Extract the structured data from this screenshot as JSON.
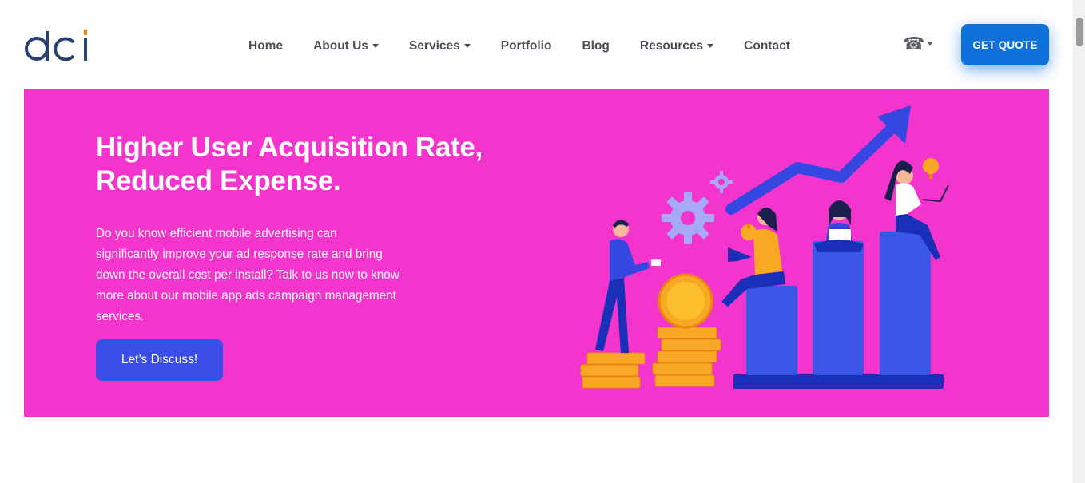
{
  "header": {
    "logo_text": "dci",
    "nav": [
      {
        "label": "Home",
        "dropdown": false
      },
      {
        "label": "About Us",
        "dropdown": true
      },
      {
        "label": "Services",
        "dropdown": true
      },
      {
        "label": "Portfolio",
        "dropdown": false
      },
      {
        "label": "Blog",
        "dropdown": false
      },
      {
        "label": "Resources",
        "dropdown": true
      },
      {
        "label": "Contact",
        "dropdown": false
      }
    ],
    "phone_icon": "telephone-icon",
    "quote_label": "GET QUOTE"
  },
  "hero": {
    "title_line1": "Higher User Acquisition Rate,",
    "title_line2": "Reduced Expense.",
    "text": "Do you know efficient mobile advertising can significantly improve your ad response rate and bring down the overall cost per install? Talk to us now to know more about our mobile app ads campaign management services.",
    "button_label": "Let’s Discuss!"
  },
  "colors": {
    "hero_bg": "#f334cd",
    "primary_blue": "#0e71d9",
    "discuss_blue": "#3b4fe8",
    "logo_navy": "#2b4270",
    "logo_orange": "#f28c1b",
    "nav_text": "#4a4f57"
  }
}
